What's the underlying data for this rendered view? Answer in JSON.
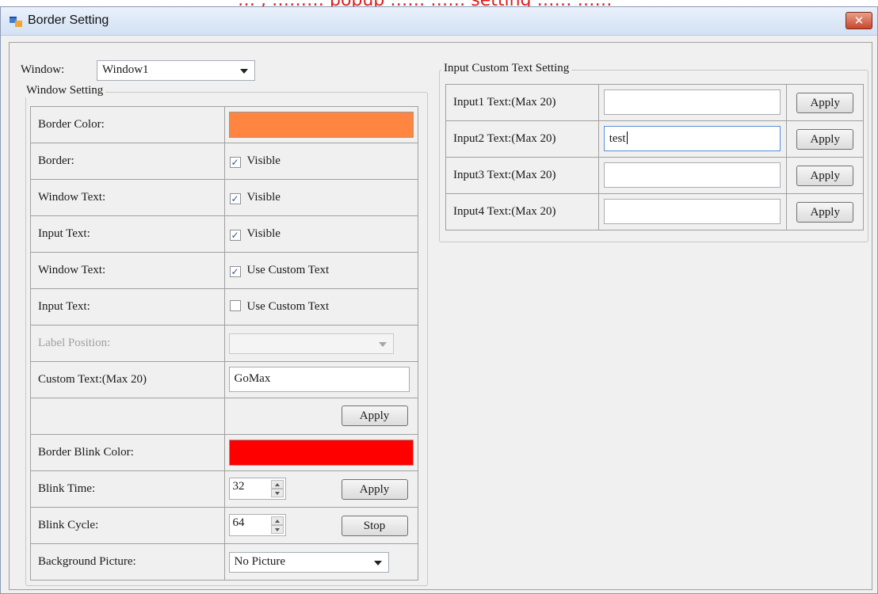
{
  "caption": "… , ……… popup …… …… setting …… ……",
  "window": {
    "title": "Border Setting",
    "close_glyph": "✕"
  },
  "window_select": {
    "label": "Window:",
    "value": "Window1"
  },
  "window_setting": {
    "group_title": "Window Setting",
    "border_color": {
      "label": "Border Color:",
      "color": "#ff8540"
    },
    "border": {
      "label": "Border:",
      "checked": true,
      "text": "Visible"
    },
    "window_text_visible": {
      "label": "Window Text:",
      "checked": true,
      "text": "Visible"
    },
    "input_text_visible": {
      "label": "Input Text:",
      "checked": true,
      "text": "Visible"
    },
    "window_text_custom": {
      "label": "Window Text:",
      "checked": true,
      "text": "Use Custom Text"
    },
    "input_text_custom": {
      "label": "Input Text:",
      "checked": false,
      "text": "Use Custom Text"
    },
    "label_position": {
      "label": "Label Position:",
      "value": ""
    },
    "custom_text": {
      "label": "Custom Text:(Max 20)",
      "value": "GoMax"
    },
    "apply_label": "Apply",
    "blink_color": {
      "label": "Border Blink Color:",
      "color": "#ff0000"
    },
    "blink_time": {
      "label": "Blink Time:",
      "value": "32",
      "button": "Apply"
    },
    "blink_cycle": {
      "label": "Blink Cycle:",
      "value": "64",
      "button": "Stop"
    },
    "background_picture": {
      "label": "Background Picture:",
      "value": "No Picture"
    }
  },
  "input_custom": {
    "group_title": "Input Custom Text Setting",
    "rows": [
      {
        "label": "Input1  Text:(Max 20)",
        "value": "",
        "button": "Apply"
      },
      {
        "label": "Input2  Text:(Max 20)",
        "value": "test",
        "button": "Apply"
      },
      {
        "label": "Input3  Text:(Max 20)",
        "value": "",
        "button": "Apply"
      },
      {
        "label": "Input4  Text:(Max 20)",
        "value": "",
        "button": "Apply"
      }
    ]
  },
  "check_glyph": "✓"
}
